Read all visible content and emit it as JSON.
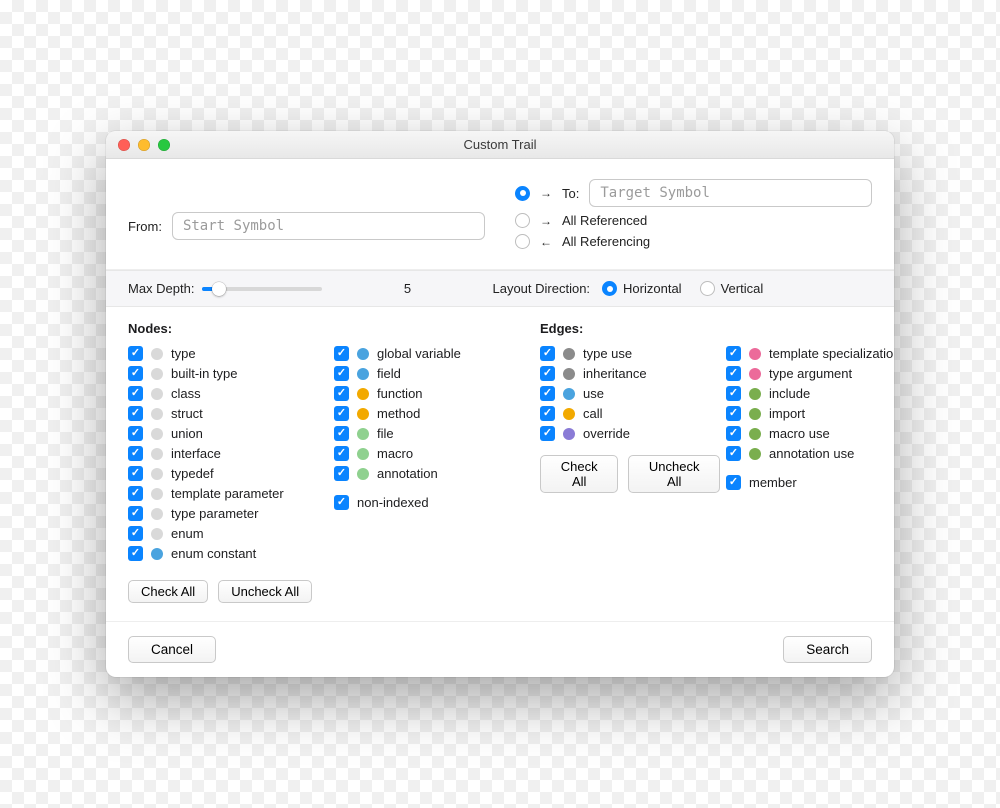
{
  "window": {
    "title": "Custom Trail"
  },
  "from": {
    "label": "From:",
    "placeholder": "Start Symbol"
  },
  "to_options": {
    "to": {
      "label": "To:",
      "arrow": "→",
      "checked": true,
      "placeholder": "Target Symbol"
    },
    "ref": {
      "label": "All Referenced",
      "arrow": "→",
      "checked": false
    },
    "refg": {
      "label": "All Referencing",
      "arrow": "←",
      "checked": false
    }
  },
  "depth": {
    "label": "Max Depth:",
    "value": "5"
  },
  "layout": {
    "label": "Layout Direction:",
    "horizontal": {
      "label": "Horizontal",
      "checked": true
    },
    "vertical": {
      "label": "Vertical",
      "checked": false
    }
  },
  "nodes_title": "Nodes:",
  "edges_title": "Edges:",
  "nodes_col1": [
    {
      "label": "type",
      "color": "#d9d9d9"
    },
    {
      "label": "built-in type",
      "color": "#d9d9d9"
    },
    {
      "label": "class",
      "color": "#d9d9d9"
    },
    {
      "label": "struct",
      "color": "#d9d9d9"
    },
    {
      "label": "union",
      "color": "#d9d9d9"
    },
    {
      "label": "interface",
      "color": "#d9d9d9"
    },
    {
      "label": "typedef",
      "color": "#d9d9d9"
    },
    {
      "label": "template parameter",
      "color": "#d9d9d9"
    },
    {
      "label": "type parameter",
      "color": "#d9d9d9"
    },
    {
      "label": "enum",
      "color": "#d9d9d9"
    },
    {
      "label": "enum constant",
      "color": "#4aa3df"
    }
  ],
  "nodes_col2": [
    {
      "label": "global variable",
      "color": "#4aa3df"
    },
    {
      "label": "field",
      "color": "#4aa3df"
    },
    {
      "label": "function",
      "color": "#f2a900"
    },
    {
      "label": "method",
      "color": "#f2a900"
    },
    {
      "label": "file",
      "color": "#8fd18f"
    },
    {
      "label": "macro",
      "color": "#8fd18f"
    },
    {
      "label": "annotation",
      "color": "#8fd18f"
    }
  ],
  "nodes_nonindexed": {
    "label": "non-indexed"
  },
  "edges_col1": [
    {
      "label": "type use",
      "color": "#8b8b8b"
    },
    {
      "label": "inheritance",
      "color": "#8b8b8b"
    },
    {
      "label": "use",
      "color": "#4aa3df"
    },
    {
      "label": "call",
      "color": "#f2a900"
    },
    {
      "label": "override",
      "color": "#8a7bd6"
    }
  ],
  "edges_col2": [
    {
      "label": "template specialization",
      "color": "#ec6a9a"
    },
    {
      "label": "type argument",
      "color": "#ec6a9a"
    },
    {
      "label": "include",
      "color": "#7aae4e"
    },
    {
      "label": "import",
      "color": "#7aae4e"
    },
    {
      "label": "macro use",
      "color": "#7aae4e"
    },
    {
      "label": "annotation use",
      "color": "#7aae4e"
    }
  ],
  "edges_member": {
    "label": "member"
  },
  "buttons": {
    "check_all": "Check All",
    "uncheck_all": "Uncheck All",
    "cancel": "Cancel",
    "search": "Search"
  }
}
